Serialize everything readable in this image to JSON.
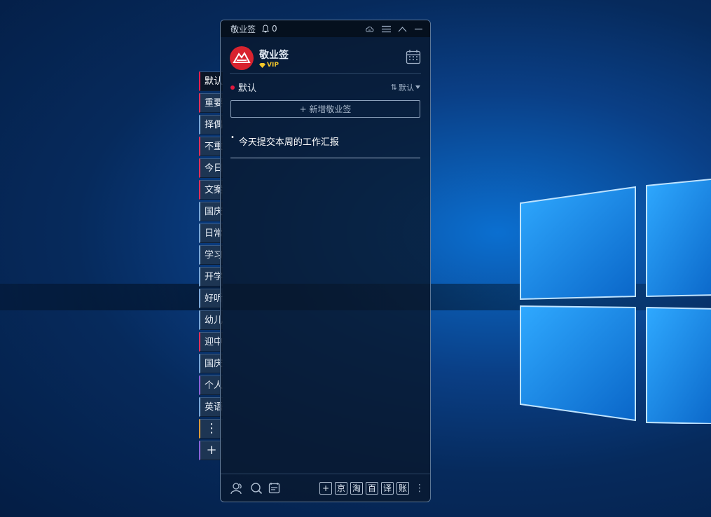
{
  "titlebar": {
    "app_title": "敬业签",
    "notif_count": "0"
  },
  "user": {
    "name": "敬业签",
    "badge": "VIP"
  },
  "group": {
    "name": "默认",
    "sort_label": "默认"
  },
  "add_note_label": "+ 新增敬业签",
  "notes": [
    {
      "text": "今天提交本周的工作汇报"
    }
  ],
  "side_tabs": [
    {
      "label": "默认",
      "state": "active",
      "accent": "#e61e4d"
    },
    {
      "label": "重要",
      "accent": "#e0305a"
    },
    {
      "label": "择偶",
      "accent": "#7aa7d8"
    },
    {
      "label": "不重",
      "accent": "#e0305a"
    },
    {
      "label": "今日",
      "accent": "#e0305a"
    },
    {
      "label": "文案",
      "accent": "#e0305a"
    },
    {
      "label": "国庆",
      "accent": "#7aa7d8"
    },
    {
      "label": "日常",
      "accent": "#7aa7d8"
    },
    {
      "label": "学习",
      "accent": "#7aa7d8"
    },
    {
      "label": "开学",
      "accent": "#7aa7d8"
    },
    {
      "label": "好听",
      "accent": "#7aa7d8"
    },
    {
      "label": "幼儿",
      "accent": "#7aa7d8"
    },
    {
      "label": "迎中",
      "accent": "#e0305a"
    },
    {
      "label": "国庆",
      "accent": "#7aa7d8"
    },
    {
      "label": "个人",
      "accent": "#8a63d8"
    },
    {
      "label": "英语",
      "accent": "#7aa7d8"
    }
  ],
  "quick_buttons": [
    "+",
    "京",
    "淘",
    "百",
    "译",
    "账"
  ],
  "icons": {
    "bell": "bell-icon",
    "cloud": "cloud-icon",
    "menu": "menu-icon",
    "collapse": "chevron-up-icon",
    "minimize": "minimize-icon",
    "calendar": "calendar-icon",
    "contacts": "contacts-icon",
    "search": "search-icon",
    "notes": "notes-icon",
    "more": "more-icon"
  }
}
